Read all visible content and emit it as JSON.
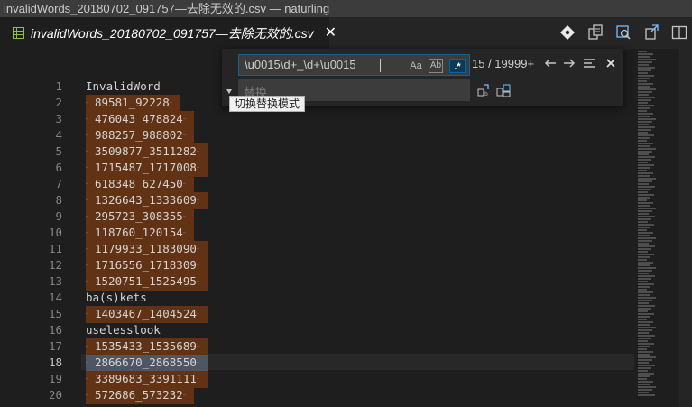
{
  "window": {
    "title": "invalidWords_20180702_091757—去除无效的.csv — naturling"
  },
  "tab": {
    "label": "invalidWords_20180702_091757—去除无效的.csv",
    "close": "✕"
  },
  "toolbar": {
    "icons": [
      "source-control-icon",
      "open-preview-icon",
      "find-in-file-icon",
      "open-changes-icon",
      "split-editor-icon"
    ]
  },
  "find": {
    "search_value": "\\u0015\\d+_\\d+\\u0015",
    "match_case_label": "Aa",
    "whole_word_label": "Ab",
    "regex_label": ".*",
    "count": "15 / 19999+",
    "replace_placeholder": "替换",
    "tooltip": "切换替换模式"
  },
  "editor": {
    "active_line": "18",
    "lines": [
      {
        "n": "1",
        "text": "InvalidWord",
        "ctrl": false
      },
      {
        "n": "2",
        "text": "89581_92228",
        "ctrl": true
      },
      {
        "n": "3",
        "text": "476043_478824",
        "ctrl": true
      },
      {
        "n": "4",
        "text": "988257_988802",
        "ctrl": true
      },
      {
        "n": "5",
        "text": "3509877_3511282",
        "ctrl": true
      },
      {
        "n": "6",
        "text": "1715487_1717008",
        "ctrl": true
      },
      {
        "n": "7",
        "text": "618348_627450",
        "ctrl": true
      },
      {
        "n": "8",
        "text": "1326643_1333609",
        "ctrl": true
      },
      {
        "n": "9",
        "text": "295723_308355",
        "ctrl": true
      },
      {
        "n": "10",
        "text": "118760_120154",
        "ctrl": true
      },
      {
        "n": "11",
        "text": "1179933_1183090",
        "ctrl": true
      },
      {
        "n": "12",
        "text": "1716556_1718309",
        "ctrl": true
      },
      {
        "n": "13",
        "text": "1520751_1525495",
        "ctrl": true
      },
      {
        "n": "14",
        "text": "ba(s)kets",
        "ctrl": false
      },
      {
        "n": "15",
        "text": "1403467_1404524",
        "ctrl": true
      },
      {
        "n": "16",
        "text": "uselesslook",
        "ctrl": false
      },
      {
        "n": "17",
        "text": "1535433_1535689",
        "ctrl": true
      },
      {
        "n": "18",
        "text": "2866670_2868550",
        "ctrl": true
      },
      {
        "n": "19",
        "text": "3389683_3391111",
        "ctrl": true
      },
      {
        "n": "20",
        "text": "572686_573232",
        "ctrl": true
      }
    ]
  },
  "colors": {
    "editor_bg": "#1e1e1e",
    "match_highlight": "#613214",
    "current_match": "#4d5566",
    "accent": "#0e639c"
  }
}
